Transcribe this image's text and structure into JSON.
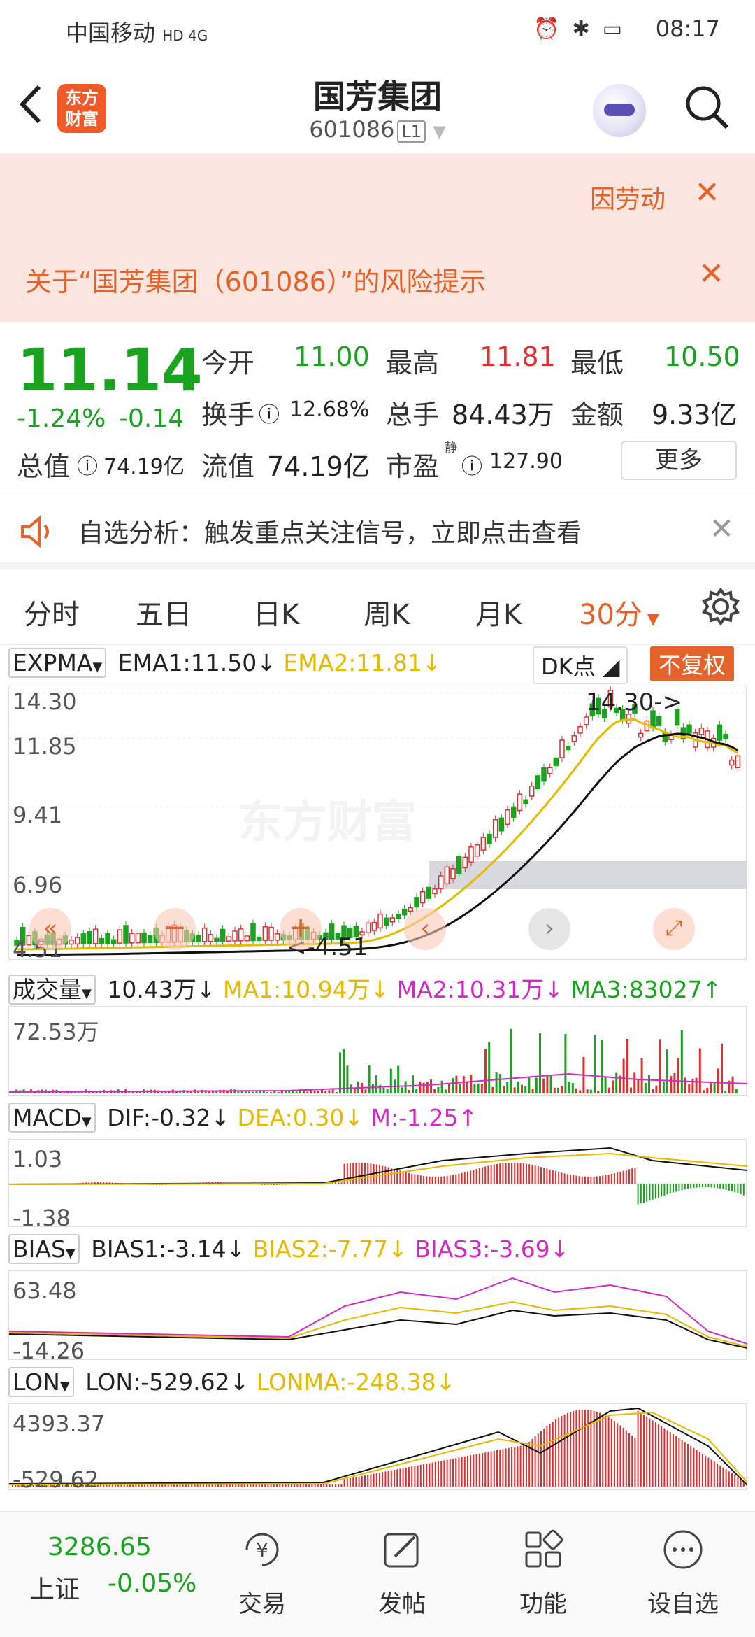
{
  "status": {
    "carrier": "中国移动",
    "network": "HD 4G",
    "time": "08:17"
  },
  "header": {
    "title": "国芳集团",
    "code": "601086",
    "level": "L1",
    "logo_text": "东方财富"
  },
  "notices": {
    "scrolling": "因劳动",
    "risk": "关于“国芳集团（601086）”的风险提示"
  },
  "quote": {
    "price": "11.14",
    "change_pct": "-1.24%",
    "change": "-0.14",
    "open_label": "今开",
    "open": "11.00",
    "high_label": "最高",
    "high": "11.81",
    "low_label": "最低",
    "low": "10.50",
    "turnover_label": "换手",
    "turnover": "12.68%",
    "volume_label": "总手",
    "volume": "84.43万",
    "amount_label": "金额",
    "amount": "9.33亿",
    "mcap_label": "总值",
    "mcap": "74.19亿",
    "float_label": "流值",
    "float": "74.19亿",
    "pe_label": "市盈",
    "pe_sup": "静",
    "pe": "127.90",
    "more": "更多"
  },
  "analysis": {
    "text": "自选分析：触发重点关注信号，立即点击查看"
  },
  "tabs": [
    "分时",
    "五日",
    "日K",
    "周K",
    "月K",
    "30分"
  ],
  "indicators": {
    "main": {
      "name": "EXPMA",
      "ema1": "EMA1:11.50",
      "ema2": "EMA2:11.81",
      "dk": "DK点",
      "fq": "不复权",
      "y_labels": [
        "14.30",
        "11.85",
        "9.41",
        "6.96",
        "4.51"
      ],
      "max_note": "14.30->",
      "min_note": "<-4.51",
      "watermark": "东方财富"
    },
    "vol": {
      "name": "成交量",
      "v": "10.43万",
      "ma1": "MA1:10.94万",
      "ma2": "MA2:10.31万",
      "ma3": "MA3:83027",
      "y_label": "72.53万"
    },
    "macd": {
      "name": "MACD",
      "dif": "DIF:-0.32",
      "dea": "DEA:0.30",
      "m": "M:-1.25",
      "y_labels": [
        "1.03",
        "-1.38"
      ]
    },
    "bias": {
      "name": "BIAS",
      "b1": "BIAS1:-3.14",
      "b2": "BIAS2:-7.77",
      "b3": "BIAS3:-3.69",
      "y_labels": [
        "63.48",
        "-14.26"
      ]
    },
    "lon": {
      "name": "LON",
      "lon": "LON:-529.62",
      "lonma": "LONMA:-248.38",
      "y_labels": [
        "4393.37",
        "-529.62"
      ]
    }
  },
  "bottom": {
    "index_value": "3286.65",
    "index_name": "上证",
    "index_change": "-0.05%",
    "nav": [
      "交易",
      "发帖",
      "功能",
      "设自选"
    ]
  }
}
